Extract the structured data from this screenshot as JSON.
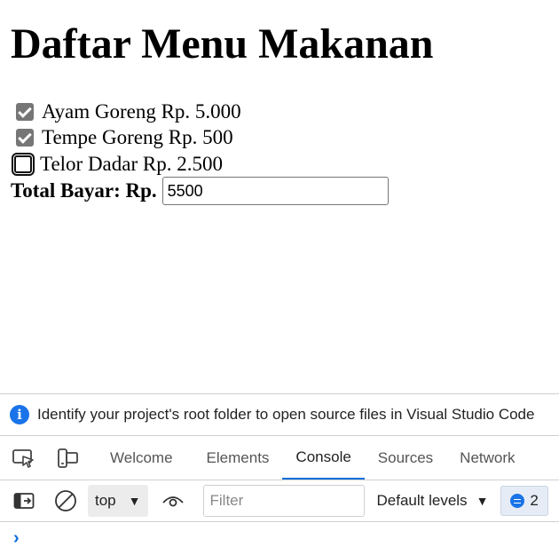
{
  "page": {
    "title": "Daftar Menu Makanan",
    "menu_items": [
      {
        "label": "Ayam Goreng Rp. 5.000",
        "checked": true
      },
      {
        "label": "Tempe Goreng Rp. 500",
        "checked": true
      },
      {
        "label": "Telor Dadar Rp. 2.500",
        "checked": false
      }
    ],
    "total_label": "Total Bayar: Rp.",
    "total_value": "5500"
  },
  "devtools": {
    "info_message": "Identify your project's root folder to open source files in Visual Studio Code",
    "tabs": [
      {
        "label": "Welcome",
        "active": false
      },
      {
        "label": "Elements",
        "active": false
      },
      {
        "label": "Console",
        "active": true
      },
      {
        "label": "Sources",
        "active": false
      },
      {
        "label": "Network",
        "active": false
      }
    ],
    "context": "top",
    "filter_placeholder": "Filter",
    "levels_label": "Default levels",
    "issues_count": "2",
    "accent_color": "#0b6ed7"
  }
}
